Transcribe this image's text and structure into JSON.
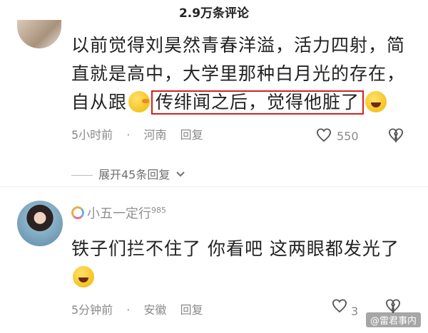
{
  "header": {
    "title": "2.9万条评论"
  },
  "comments": [
    {
      "text_before": "以前觉得刘昊然青春洋溢，活力四射，简直就是高中，大学里那种白月光的存在，自从跟",
      "highlight": "传绯闻之后，觉得他脏了",
      "time": "5小时前",
      "region": "河南",
      "reply_label": "回复",
      "likes": "550",
      "expand_label": "展开45条回复"
    },
    {
      "username": "小五一定行",
      "level": "985",
      "text": "铁子们拦不住了 你看吧 这两眼都发光了",
      "time": "5分钟前",
      "region": "安徽",
      "reply_label": "回复",
      "likes": "3"
    }
  ],
  "watermark": "@雷君事内",
  "icons": {
    "like": "heart-outline-icon",
    "dislike": "broken-heart-icon",
    "expand": "chevron-down-icon"
  }
}
